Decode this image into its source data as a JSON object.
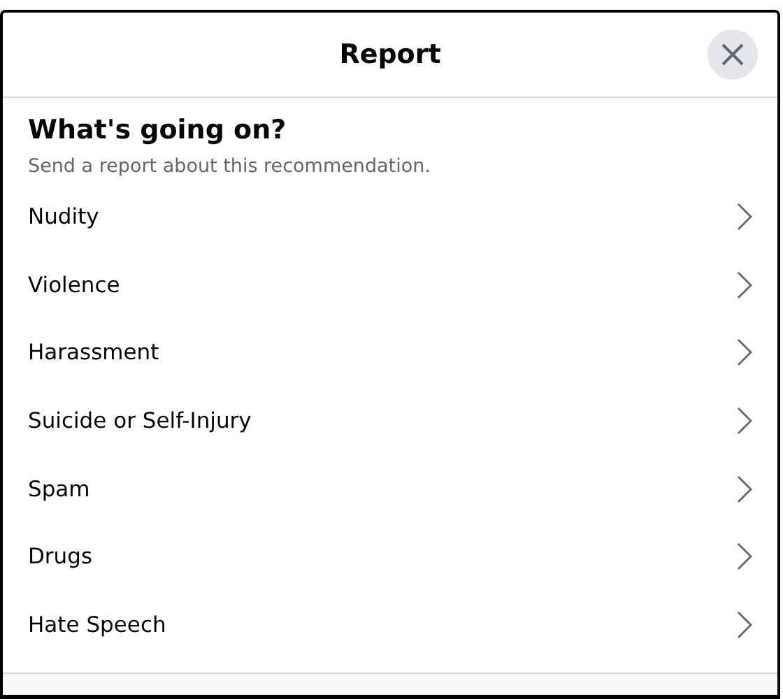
{
  "dialog": {
    "title": "Report",
    "heading": "What's going on?",
    "subtitle": "Send a report about this recommendation."
  },
  "options": [
    {
      "label": "Nudity"
    },
    {
      "label": "Violence"
    },
    {
      "label": "Harassment"
    },
    {
      "label": "Suicide or Self-Injury"
    },
    {
      "label": "Spam"
    },
    {
      "label": "Drugs"
    },
    {
      "label": "Hate Speech"
    }
  ]
}
